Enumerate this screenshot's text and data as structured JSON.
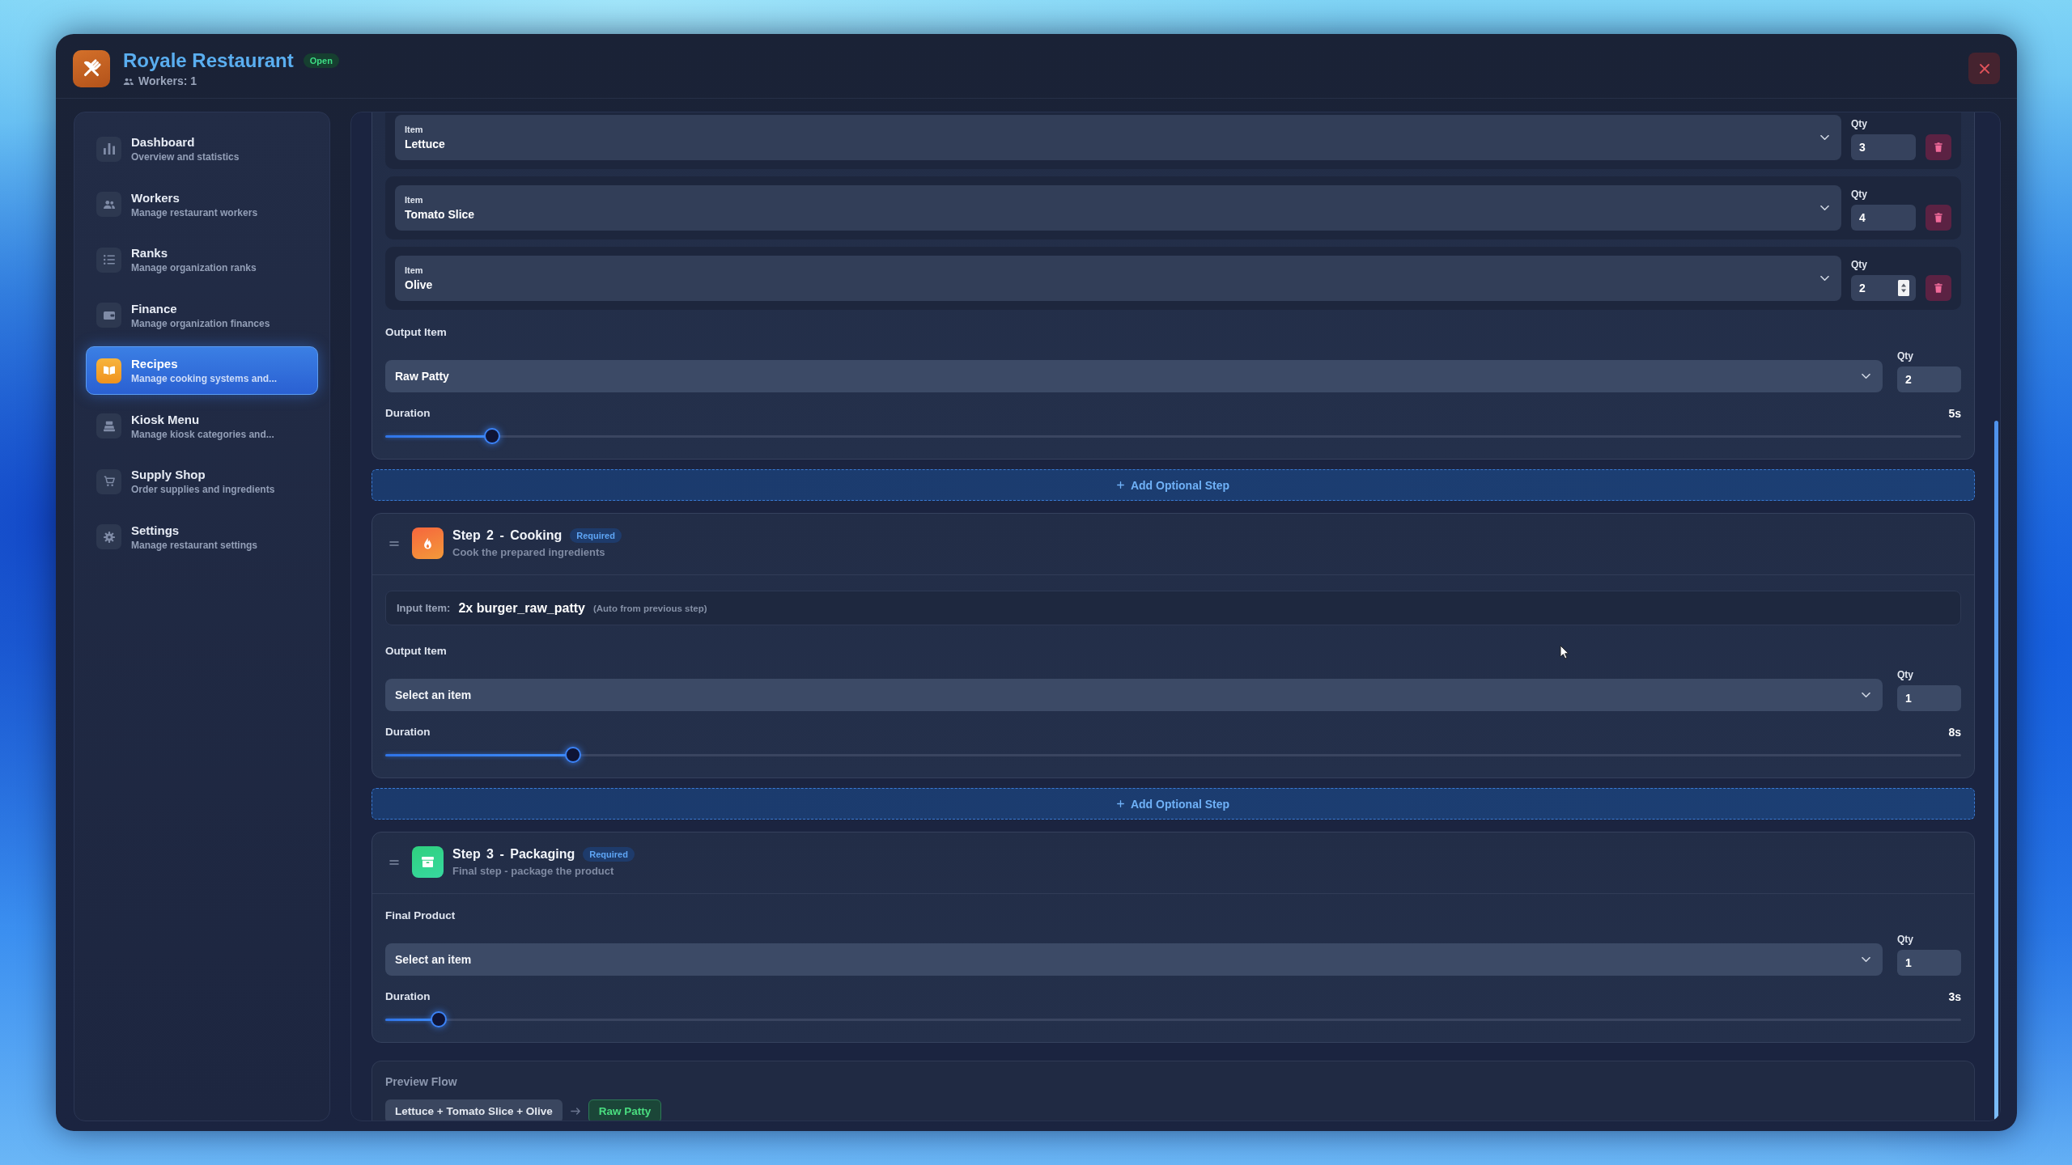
{
  "window": {
    "title": "Royale Restaurant",
    "status": "Open",
    "workers": "Workers: 1"
  },
  "sidebar": {
    "items": [
      {
        "title": "Dashboard",
        "subtitle": "Overview and statistics",
        "selected": false
      },
      {
        "title": "Workers",
        "subtitle": "Manage restaurant workers",
        "selected": false
      },
      {
        "title": "Ranks",
        "subtitle": "Manage organization ranks",
        "selected": false
      },
      {
        "title": "Finance",
        "subtitle": "Manage organization finances",
        "selected": false
      },
      {
        "title": "Recipes",
        "subtitle": "Manage cooking systems and...",
        "selected": true
      },
      {
        "title": "Kiosk Menu",
        "subtitle": "Manage kiosk categories and...",
        "selected": false
      },
      {
        "title": "Supply Shop",
        "subtitle": "Order supplies and ingredients",
        "selected": false
      },
      {
        "title": "Settings",
        "subtitle": "Manage restaurant settings",
        "selected": false
      }
    ]
  },
  "steps": [
    {
      "ingredients": [
        {
          "label": "Item",
          "value": "Lettuce",
          "qty_label": "Qty",
          "qty": "3",
          "hovered": false
        },
        {
          "label": "Item",
          "value": "Tomato Slice",
          "qty_label": "Qty",
          "qty": "4",
          "hovered": false
        },
        {
          "label": "Item",
          "value": "Olive",
          "qty_label": "Qty",
          "qty": "2",
          "hovered": true
        }
      ],
      "output": {
        "label": "Output Item",
        "value": "Raw Patty",
        "qty_label": "Qty",
        "qty": "2"
      },
      "duration": {
        "label": "Duration",
        "reading": "5s",
        "level": 0.068
      }
    },
    {
      "kind": "cooking",
      "title": "Step 2 - Cooking",
      "badge": "Required",
      "description": "Cook the prepared ingredients",
      "input": {
        "label": "Input Item:",
        "value": "2x burger_raw_patty",
        "note": "(Auto from previous step)"
      },
      "output": {
        "label": "Output Item",
        "placeholder": "Select an item",
        "qty_label": "Qty",
        "qty": "1"
      },
      "duration": {
        "label": "Duration",
        "reading": "8s",
        "level": 0.119
      }
    },
    {
      "kind": "packaging",
      "title": "Step 3 - Packaging",
      "badge": "Required",
      "description": "Final step - package the product",
      "output": {
        "label": "Final Product",
        "placeholder": "Select an item",
        "qty_label": "Qty",
        "qty": "1"
      },
      "duration": {
        "label": "Duration",
        "reading": "3s",
        "level": 0.034
      }
    }
  ],
  "add_buttons": [
    "Add Optional Step",
    "Add Optional Step"
  ],
  "preview": {
    "title": "Preview Flow",
    "inputs": "Lettuce + Tomato Slice + Olive",
    "output": "Raw Patty"
  }
}
